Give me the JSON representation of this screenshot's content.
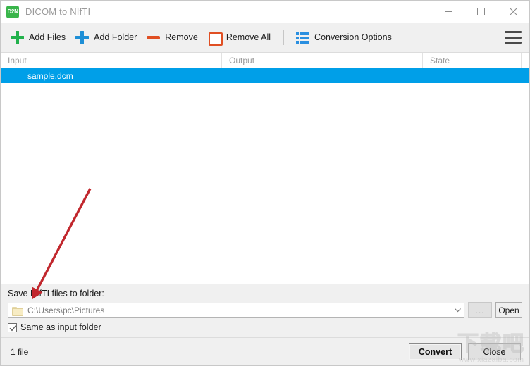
{
  "window": {
    "title": "DICOM to NIfTI",
    "app_icon_text": "D2N",
    "app_icon_color": "#39b54a",
    "minimize_label": "Minimize",
    "maximize_label": "Maximize",
    "close_label": "Close"
  },
  "toolbar": {
    "items": [
      {
        "label": "Add Files",
        "icon": "plus-green-icon",
        "color": "#22b14c"
      },
      {
        "label": "Add Folder",
        "icon": "plus-blue-icon",
        "color": "#1e8fd6"
      },
      {
        "label": "Remove",
        "icon": "minus-icon",
        "color": "#e04f23"
      },
      {
        "label": "Remove All",
        "icon": "square-outline-icon",
        "color": "#e04f23"
      },
      {
        "label": "Conversion Options",
        "icon": "list-options-icon",
        "color": "#2a8fe0"
      }
    ],
    "menu_icon": "hamburger-menu-icon"
  },
  "file_list": {
    "columns": [
      "Input",
      "Output",
      "State"
    ],
    "rows": [
      {
        "input": "sample.dcm",
        "output": "",
        "state": "",
        "selected": true
      }
    ],
    "selection_color": "#009fe8"
  },
  "output_settings": {
    "save_label": "Save NIfTI files to folder:",
    "path_value": "C:\\Users\\pc\\Pictures",
    "folder_icon": "folder-icon",
    "dropdown_icon": "chevron-down-icon",
    "browse_label": "...",
    "open_label": "Open",
    "same_as_input_label": "Same as input folder",
    "same_as_input_checked": true
  },
  "status_bar": {
    "file_count": "1 file",
    "convert_label": "Convert",
    "close_label": "Close"
  },
  "watermark": {
    "text": "下载吧",
    "url": "www.xiazaiba.com"
  },
  "annotation": {
    "arrow_color": "#c1272d",
    "description": "red arrow pointing to save folder label"
  }
}
